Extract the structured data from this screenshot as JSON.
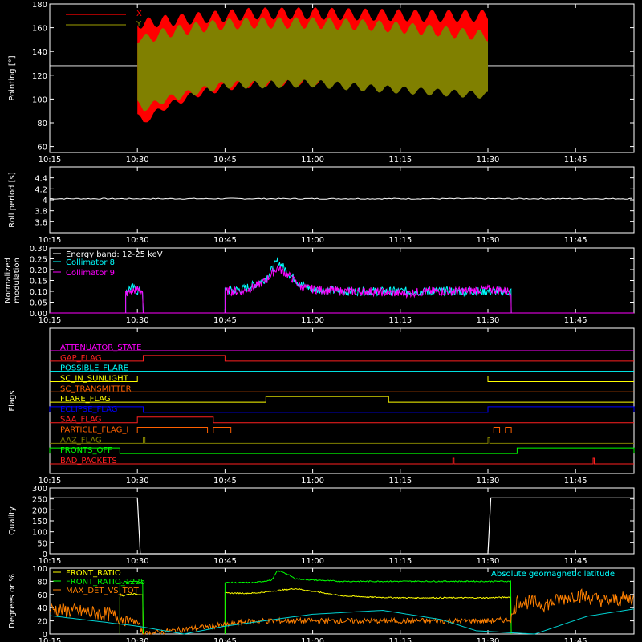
{
  "chart_data": [
    {
      "type": "line",
      "ylabel": "Pointing [°]",
      "xlim": [
        "10:15",
        "11:55"
      ],
      "ylim": [
        55,
        180
      ],
      "yticks": [
        60,
        80,
        100,
        120,
        140,
        160,
        180
      ],
      "xticks": [
        "10:15",
        "10:30",
        "10:45",
        "11:00",
        "11:15",
        "11:30",
        "11:45"
      ],
      "grid": false,
      "legend": "top-left",
      "reference_line": 128,
      "series": [
        {
          "name": "X",
          "color": "#ff0000",
          "x": [
            "10:30",
            "10:31",
            "10:33",
            "10:35",
            "10:40",
            "10:45",
            "10:50",
            "11:00",
            "11:10",
            "11:20",
            "11:30"
          ],
          "min": [
            86,
            80,
            88,
            94,
            104,
            110,
            113,
            115,
            115,
            116,
            116
          ],
          "max": [
            165,
            163,
            165,
            166,
            168,
            170,
            172,
            172,
            171,
            170,
            170
          ]
        },
        {
          "name": "Y",
          "color": "#808000",
          "x": [
            "10:30",
            "10:31",
            "10:33",
            "10:35",
            "10:40",
            "10:45",
            "10:50",
            "11:00",
            "11:10",
            "11:20",
            "11:30"
          ],
          "min": [
            96,
            92,
            96,
            100,
            106,
            112,
            112,
            113,
            109,
            106,
            103
          ],
          "max": [
            152,
            150,
            153,
            156,
            160,
            163,
            164,
            164,
            162,
            158,
            153
          ]
        }
      ]
    },
    {
      "type": "line",
      "ylabel": "Roll period [s]",
      "xlim": [
        "10:15",
        "11:55"
      ],
      "ylim": [
        3.4,
        4.6
      ],
      "yticks": [
        3.6,
        3.8,
        4.0,
        4.2,
        4.4
      ],
      "xticks": [
        "10:15",
        "10:30",
        "10:45",
        "11:00",
        "11:15",
        "11:30",
        "11:45"
      ],
      "series": [
        {
          "name": "",
          "color": "#ffffff",
          "x": [
            "10:15",
            "11:55"
          ],
          "y": [
            4.02,
            4.02
          ]
        }
      ]
    },
    {
      "type": "line",
      "ylabel": "Normalized\nmodulation",
      "xlim": [
        "10:15",
        "11:55"
      ],
      "ylim": [
        0,
        0.3
      ],
      "yticks": [
        0.0,
        0.05,
        0.1,
        0.15,
        0.2,
        0.25,
        0.3
      ],
      "ytick_labels": [
        "0.00",
        "0.05",
        "0.10",
        "0.15",
        "0.20",
        "0.25",
        "0.30"
      ],
      "xticks": [
        "10:15",
        "10:30",
        "10:45",
        "11:00",
        "11:15",
        "11:30",
        "11:45"
      ],
      "legend_title": "Energy band: 12-25 keV",
      "series": [
        {
          "name": "Collimator 8",
          "color": "#00ffff",
          "segments": [
            {
              "x": [
                "10:28",
                "10:29",
                "10:30",
                "10:31"
              ],
              "y": [
                0.1,
                0.12,
                0.1,
                0.11
              ]
            },
            {
              "x": [
                "10:45",
                "10:48",
                "10:50",
                "10:52",
                "10:54",
                "10:56",
                "10:58",
                "11:00",
                "11:05",
                "11:10",
                "11:15",
                "11:20",
                "11:25",
                "11:30",
                "11:34"
              ],
              "y": [
                0.1,
                0.11,
                0.13,
                0.16,
                0.24,
                0.18,
                0.13,
                0.11,
                0.1,
                0.1,
                0.1,
                0.1,
                0.1,
                0.1,
                0.1
              ]
            }
          ]
        },
        {
          "name": "Collimator 9",
          "color": "#ff00ff",
          "segments": [
            {
              "x": [
                "10:28",
                "10:29",
                "10:30",
                "10:31"
              ],
              "y": [
                0.09,
                0.1,
                0.11,
                0.1
              ]
            },
            {
              "x": [
                "10:45",
                "10:48",
                "10:50",
                "10:52",
                "10:54",
                "10:56",
                "10:58",
                "11:00",
                "11:05",
                "11:10",
                "11:15",
                "11:20",
                "11:25",
                "11:30",
                "11:34"
              ],
              "y": [
                0.1,
                0.1,
                0.12,
                0.15,
                0.21,
                0.17,
                0.12,
                0.11,
                0.1,
                0.1,
                0.09,
                0.1,
                0.1,
                0.11,
                0.1
              ]
            }
          ]
        }
      ]
    },
    {
      "type": "line",
      "ylabel": "Flags",
      "xlim": [
        "10:15",
        "11:55"
      ],
      "xticks": [
        "10:15",
        "10:30",
        "10:45",
        "11:00",
        "11:15",
        "11:30",
        "11:45"
      ],
      "flags": [
        {
          "name": "ATTENUATOR_STATE",
          "color": "#ff00ff",
          "transitions": []
        },
        {
          "name": "GAP_FLAG",
          "color": "#ff2020",
          "transitions": [
            {
              "start": "10:31",
              "end": "10:45"
            }
          ]
        },
        {
          "name": "POSSIBLE_FLARE",
          "color": "#00ffff",
          "transitions": []
        },
        {
          "name": "SC_IN_SUNLIGHT",
          "color": "#ffff00",
          "transitions": [
            {
              "start": "10:15",
              "end": "10:30",
              "state": "low"
            },
            {
              "start": "11:30",
              "end": "11:55",
              "state": "low"
            }
          ]
        },
        {
          "name": "SC_TRANSMITTER",
          "color": "#ff6000",
          "transitions": []
        },
        {
          "name": "FLARE_FLAG",
          "color": "#ffff00",
          "transitions": [
            {
              "start": "10:52",
              "end": "11:13"
            }
          ]
        },
        {
          "name": "ECLIPSE_FLAG",
          "color": "#0000ff",
          "transitions": [
            {
              "start": "10:15",
              "end": "10:31"
            },
            {
              "start": "11:30",
              "end": "11:55"
            }
          ]
        },
        {
          "name": "SAA_FLAG",
          "color": "#ff2020",
          "transitions": [
            {
              "start": "10:30",
              "end": "10:43"
            }
          ]
        },
        {
          "name": "PARTICLE_FLAG_I",
          "color": "#ff6000",
          "transitions": [
            {
              "start": "10:30",
              "end": "10:42"
            },
            {
              "start": "10:43",
              "end": "10:46"
            },
            {
              "start": "11:31",
              "end": "11:32"
            },
            {
              "start": "11:33",
              "end": "11:34"
            }
          ]
        },
        {
          "name": "AAZ_FLAG",
          "color": "#808000",
          "transitions": [
            {
              "start": "10:31",
              "end": "10:31.3"
            },
            {
              "start": "11:30",
              "end": "11:30.3"
            }
          ]
        },
        {
          "name": "FRONTS_OFF",
          "color": "#00ff00",
          "transitions": [
            {
              "start": "10:15",
              "end": "10:27"
            },
            {
              "start": "11:35",
              "end": "11:55"
            }
          ]
        },
        {
          "name": "BAD_PACKETS",
          "color": "#ff2020",
          "transitions": [
            {
              "start": "11:24",
              "end": "11:24.2"
            },
            {
              "start": "11:48",
              "end": "11:48.2"
            }
          ]
        }
      ]
    },
    {
      "type": "line",
      "ylabel": "Quality",
      "xlim": [
        "10:15",
        "11:55"
      ],
      "ylim": [
        0,
        300
      ],
      "yticks": [
        0,
        50,
        100,
        150,
        200,
        250,
        300
      ],
      "xticks": [
        "10:15",
        "10:30",
        "10:45",
        "11:00",
        "11:15",
        "11:30",
        "11:45"
      ],
      "series": [
        {
          "name": "",
          "color": "#ffffff",
          "x": [
            "10:15",
            "10:30",
            "10:30.5",
            "11:30",
            "11:30.5",
            "11:55"
          ],
          "y": [
            255,
            255,
            0,
            0,
            255,
            255
          ]
        }
      ]
    },
    {
      "type": "line",
      "ylabel": "Degrees or %",
      "xlim": [
        "10:15",
        "11:55"
      ],
      "ylim": [
        0,
        100
      ],
      "yticks": [
        0,
        20,
        40,
        60,
        80,
        100
      ],
      "xticks": [
        "10:15",
        "10:30",
        "10:45",
        "11:00",
        "11:15",
        "11:30",
        "11:45"
      ],
      "legend_right": "Absolute geomagnetic latitude",
      "series": [
        {
          "name": "FRONT_RATIO",
          "color": "#ffff00",
          "segments": [
            {
              "x": [
                "10:27",
                "10:29",
                "10:31"
              ],
              "y": [
                58,
                61,
                60
              ]
            },
            {
              "x": [
                "10:45",
                "10:50",
                "10:55",
                "10:57",
                "11:00",
                "11:05",
                "11:10",
                "11:15",
                "11:20",
                "11:25",
                "11:30",
                "11:34"
              ],
              "y": [
                62,
                62,
                67,
                69,
                65,
                58,
                56,
                55,
                55,
                55,
                55,
                56
              ]
            }
          ]
        },
        {
          "name": "FRONT_RATIO_1225",
          "color": "#00ff00",
          "segments": [
            {
              "x": [
                "10:27",
                "10:29",
                "10:31"
              ],
              "y": [
                78,
                80,
                79
              ]
            },
            {
              "x": [
                "10:45",
                "10:50",
                "10:53",
                "10:54",
                "10:55",
                "10:57",
                "11:00",
                "11:05",
                "11:15",
                "11:25",
                "11:34"
              ],
              "y": [
                78,
                78,
                82,
                96,
                94,
                84,
                82,
                80,
                80,
                80,
                80
              ]
            }
          ]
        },
        {
          "name": "MAX_DET_VS_TOT",
          "color": "#ff8000",
          "x": [
            "10:15",
            "10:20",
            "10:25",
            "10:27",
            "10:30",
            "10:31",
            "10:45",
            "10:50",
            "11:00",
            "11:15",
            "11:30",
            "11:34",
            "11:35",
            "11:40",
            "11:45",
            "11:50",
            "11:55"
          ],
          "y": [
            38,
            34,
            30,
            25,
            18,
            0,
            14,
            20,
            20,
            20,
            20,
            22,
            50,
            45,
            60,
            50,
            55
          ]
        },
        {
          "name": "Absolute geomagnetic latitude",
          "color": "#00d0d0",
          "x": [
            "10:15",
            "10:30",
            "10:38",
            "10:45",
            "11:00",
            "11:12",
            "11:22",
            "11:28",
            "11:38",
            "11:47",
            "11:55"
          ],
          "y": [
            28,
            12,
            0,
            12,
            30,
            36,
            22,
            5,
            0,
            27,
            38
          ]
        }
      ]
    }
  ]
}
